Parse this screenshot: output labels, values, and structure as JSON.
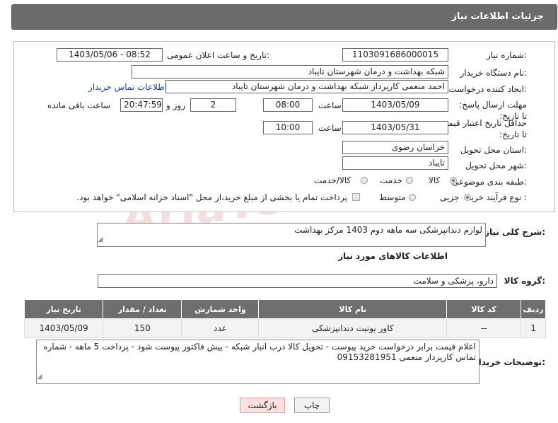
{
  "header": {
    "title": "جزئیات اطلاعات نیاز"
  },
  "form": {
    "need_number_label": "شماره نیاز:",
    "need_number": "1103091686000015",
    "announce_label": "تاریخ و ساعت اعلان عمومی:",
    "announce_value": "1403/05/06 - 08:52",
    "buyer_org_label": "نام دستگاه خریدار:",
    "buyer_org": "شبکه بهداشت و درمان شهرستان تایباد",
    "requester_label": "ایجاد کننده درخواست:",
    "requester": "احمد منعمی کارپرداز شبکه بهداشت و درمان شهرستان تایباد",
    "contact_link": "اطلاعات تماس خریدار",
    "reply_deadline_label": "مهلت ارسال پاسخ: تا تاریخ:",
    "reply_date": "1403/05/09",
    "time_label": "ساعت",
    "reply_time": "08:00",
    "days_value": "2",
    "days_label": "روز و",
    "remaining_time": "20:47:59",
    "remaining_label": "ساعت باقی مانده",
    "price_validity_label": "حداقل تاریخ اعتبار قیمت: تا تاریخ:",
    "price_date": "1403/05/31",
    "price_time": "10:00",
    "province_label": "استان محل تحویل:",
    "province": "خراسان رضوی",
    "city_label": "شهر محل تحویل:",
    "city": "تایباد",
    "category_label": "طبقه بندی موضوعی:",
    "category_options": [
      "کالا",
      "خدمت",
      "کالا/خدمت"
    ],
    "process_label": "نوع فرآیند خرید :",
    "process_options": [
      "جزیی",
      "متوسط"
    ],
    "payment_note": "پرداخت تمام یا بخشی از مبلغ خرید،از محل \"اسناد خزانه اسلامی\" خواهد بود."
  },
  "description": {
    "label": "شرح کلی نیاز:",
    "value": "لوازم دندانپزشکی سه ماهه دوم 1403 مرکز بهداشت"
  },
  "goods": {
    "section_title": "اطلاعات کالاهای مورد نیاز",
    "group_label": "گروه کالا:",
    "group_value": "دارو، پزشکی و سلامت",
    "columns": [
      "ردیف",
      "کد کالا",
      "نام کالا",
      "واحد شمارش",
      "تعداد / مقدار",
      "تاریخ نیاز"
    ],
    "rows": [
      [
        "1",
        "--",
        "کاور یونیت دندانپزشکی",
        "عدد",
        "150",
        "1403/05/09"
      ]
    ]
  },
  "buyer_notes": {
    "label": "توضیحات خریدار:",
    "value": "اعلام قیمت برابر درخواست خرید پیوست - تحویل کالا درب انبار شبکه - پیش فاکتور پیوست شود - پرداخت 5 ماهه - شماره تماس کارپرداز منعمی 09153281951"
  },
  "buttons": {
    "print": "چاپ",
    "back": "بازگشت"
  },
  "watermark": "AriaTender.neT"
}
